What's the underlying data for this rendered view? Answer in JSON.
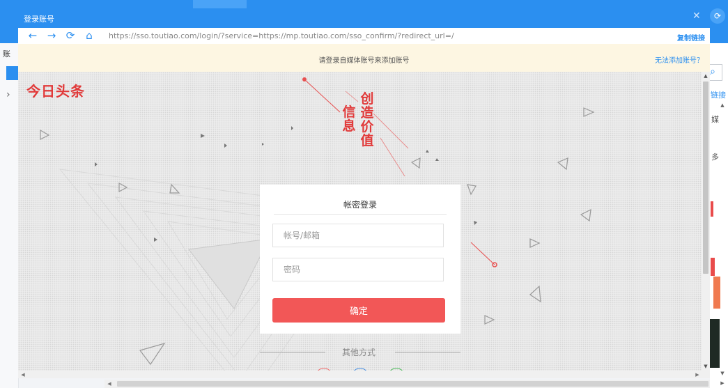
{
  "app_background": {
    "left_label": "账",
    "left_chevron": "chevron-right-icon",
    "right_labels": [
      "链接",
      "媒",
      "多"
    ],
    "right_badge_icon": "refresh-icon",
    "right_search_icon": "search-icon"
  },
  "dialog": {
    "title": "登录账号",
    "close_icon": "close-icon",
    "nav": {
      "back_icon": "back-arrow-icon",
      "forward_icon": "forward-arrow-icon",
      "refresh_icon": "refresh-icon",
      "home_icon": "home-icon"
    },
    "url": "https://sso.toutiao.com/login/?service=https://mp.toutiao.com/sso_confirm/?redirect_url=/",
    "copy_link_label": "复制链接",
    "notice": "请登录自媒体账号来添加账号",
    "notice_link": "无法添加账号？"
  },
  "page": {
    "brand": "今日头条",
    "slogan_left": [
      "信",
      "息"
    ],
    "slogan_right": [
      "创",
      "造",
      "价",
      "值"
    ],
    "login": {
      "title": "帐密登录",
      "account_placeholder": "帐号/邮箱",
      "password_placeholder": "密码",
      "submit_label": "确定",
      "other_methods_label": "其他方式"
    },
    "social_icons": [
      "social-login-icon-red",
      "social-login-icon-blue",
      "social-login-icon-green"
    ]
  },
  "colors": {
    "accent_blue": "#2b8ff0",
    "brand_red": "#e13a3a",
    "button_red": "#f25757",
    "notice_bg": "#fdf6e2"
  }
}
